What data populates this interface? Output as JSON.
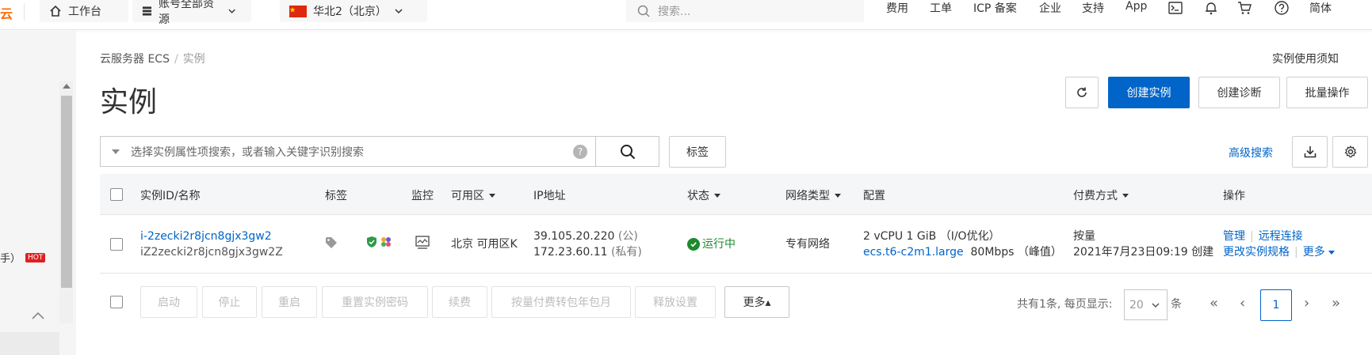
{
  "topbar": {
    "brand": "云",
    "workbench": "工作台",
    "resources": "账号全部资源",
    "region": "华北2（北京）",
    "search_placeholder": "搜索...",
    "nav": [
      "费用",
      "工单",
      "ICP 备案",
      "企业",
      "支持",
      "App"
    ],
    "lang": "简体"
  },
  "sidebar": {
    "partial_label": "手）",
    "hot_badge": "HOT"
  },
  "page": {
    "breadcrumb_root": "云服务器 ECS",
    "breadcrumb_sep": "/",
    "breadcrumb_current": "实例",
    "title": "实例",
    "notice_link": "实例使用须知",
    "create_button": "创建实例",
    "diagnose_button": "创建诊断",
    "batch_button": "批量操作",
    "filter_placeholder": "选择实例属性项搜索，或者输入关键字识别搜索",
    "tag_button": "标签",
    "advanced_search": "高级搜索"
  },
  "table": {
    "headers": {
      "id": "实例ID/名称",
      "tags": "标签",
      "monitor": "监控",
      "zone": "可用区",
      "ip": "IP地址",
      "status": "状态",
      "network": "网络类型",
      "config": "配置",
      "billing": "付费方式",
      "ops": "操作"
    },
    "row": {
      "id": "i-2zecki2r8jcn8gjx3gw2",
      "name": "iZ2zecki2r8jcn8gjx3gw2Z",
      "zone": "北京 可用区K",
      "ip_public": "39.105.20.220",
      "ip_public_tag": "(公)",
      "ip_private": "172.23.60.11",
      "ip_private_tag": "(私有)",
      "status": "运行中",
      "network": "专有网络",
      "config_line1": "2 vCPU 1 GiB （I/O优化）",
      "config_type": "ecs.t6-c2m1.large",
      "config_bw": "80Mbps （峰值）",
      "billing": "按量",
      "created": "2021年7月23日09:19 创建",
      "op_manage": "管理",
      "op_remote": "远程连接",
      "op_change": "更改实例规格",
      "op_more": "更多"
    }
  },
  "actions": {
    "start": "启动",
    "stop": "停止",
    "restart": "重启",
    "reset_password": "重置实例密码",
    "renew": "续费",
    "convert": "按量付费转包年包月",
    "release": "释放设置",
    "more": "更多▴"
  },
  "pager": {
    "summary": "共有1条, 每页显示:",
    "page_size": "20",
    "unit": "条",
    "current": "1"
  },
  "colors": {
    "primary": "#0064c8",
    "brand": "#ff6a00",
    "success": "#1d8a2d"
  }
}
